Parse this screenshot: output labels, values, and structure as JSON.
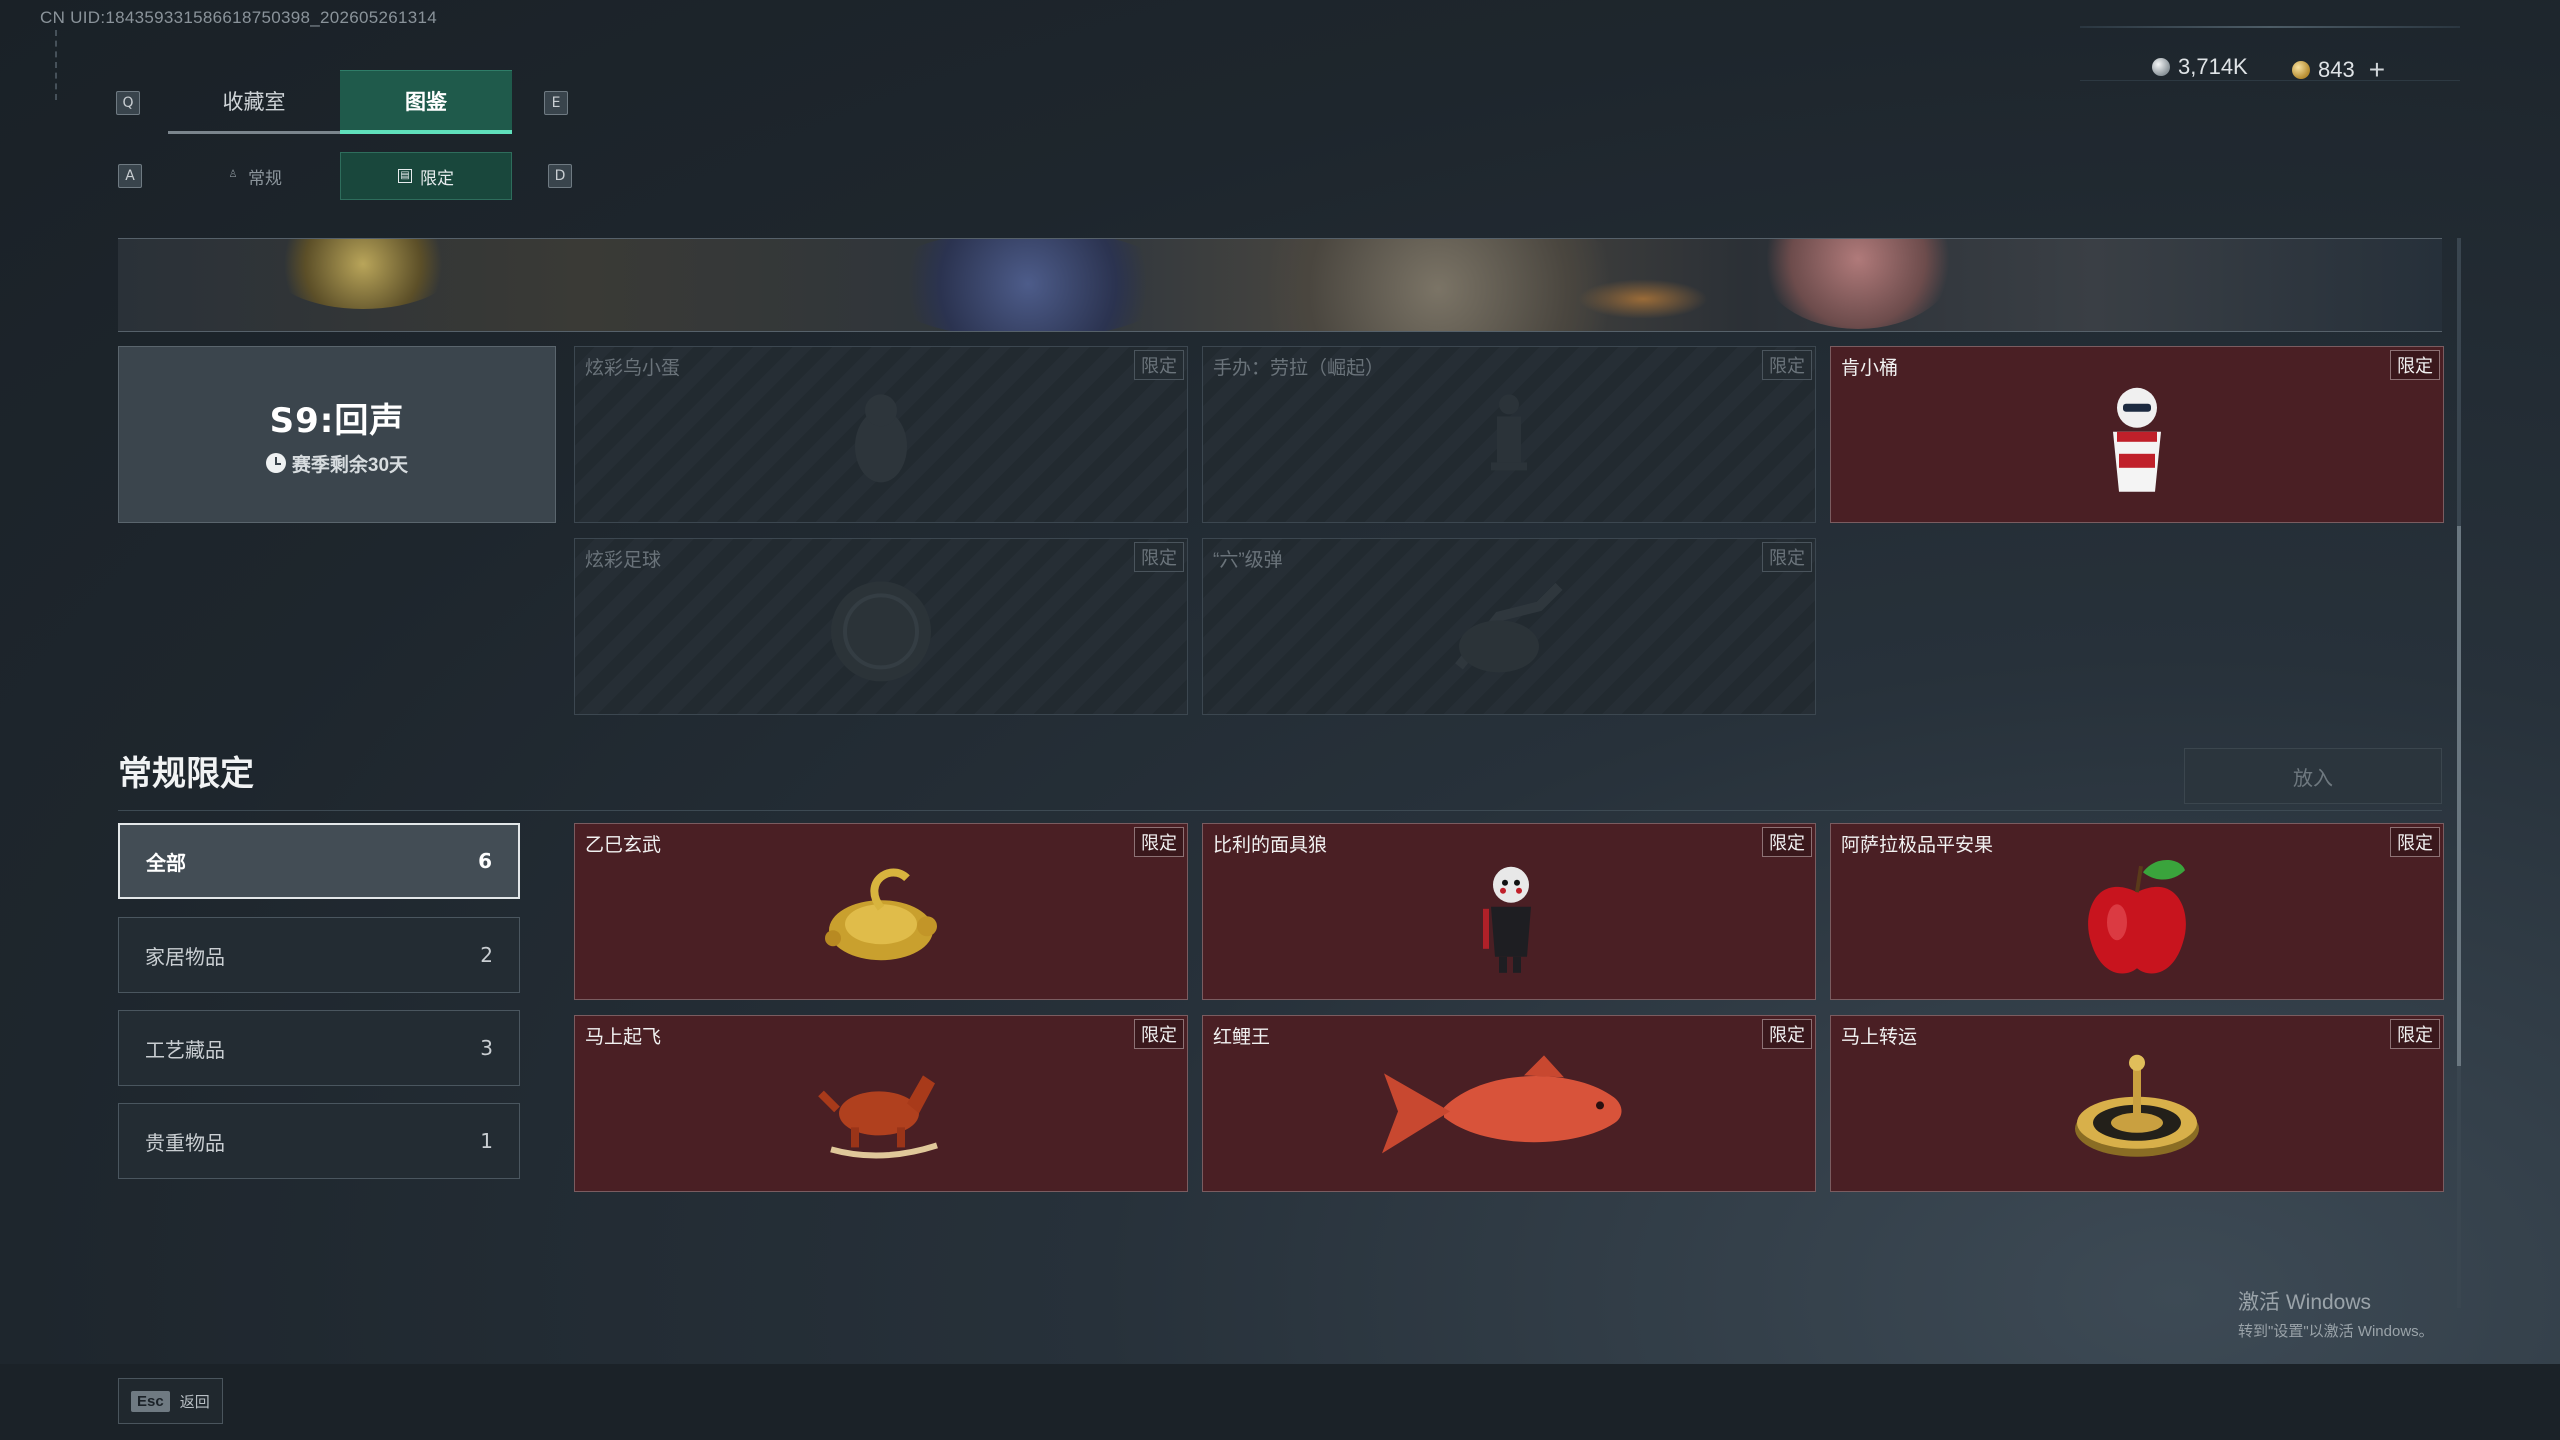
{
  "uid": "CN UID:1843593315866187503​98_202605261314",
  "nav": {
    "key_prev_tab": "Q",
    "key_next_tab": "E",
    "key_prev_sub": "A",
    "key_next_sub": "D",
    "tabs": [
      {
        "label": "收藏室"
      },
      {
        "label": "图鉴"
      }
    ],
    "subtabs": [
      {
        "label": "常规",
        "icon": "figure-icon"
      },
      {
        "label": "限定",
        "icon": "image-icon"
      }
    ]
  },
  "currency": {
    "silver": "3,714K",
    "gold": "843",
    "plus": "+"
  },
  "season": {
    "title": "S9:回声",
    "remaining": "赛季剩余30天"
  },
  "season_items": [
    {
      "name": "炫彩乌小蛋",
      "tag": "限定",
      "owned": false
    },
    {
      "name": "手办：劳拉（崛起）",
      "tag": "限定",
      "owned": false
    },
    {
      "name": "肯小桶",
      "tag": "限定",
      "owned": true
    },
    {
      "name": "炫彩足球",
      "tag": "限定",
      "owned": false
    },
    {
      "name": "“六”级弹",
      "tag": "限定",
      "owned": false
    }
  ],
  "regular": {
    "title": "常规限定",
    "put_button": "放入",
    "filters": [
      {
        "label": "全部",
        "count": "6"
      },
      {
        "label": "家居物品",
        "count": "2"
      },
      {
        "label": "工艺藏品",
        "count": "3"
      },
      {
        "label": "贵重物品",
        "count": "1"
      }
    ],
    "items": [
      {
        "name": "乙巳玄武",
        "tag": "限定"
      },
      {
        "name": "比利的面具狼",
        "tag": "限定"
      },
      {
        "name": "阿萨拉极品平安果",
        "tag": "限定"
      },
      {
        "name": "马上起飞",
        "tag": "限定"
      },
      {
        "name": "红鲤王",
        "tag": "限定"
      },
      {
        "name": "马上转运",
        "tag": "限定"
      }
    ]
  },
  "footer": {
    "esc_key": "Esc",
    "back_label": "返回"
  },
  "watermark": {
    "line1": "激活 Windows",
    "line2": "转到\"设置\"以激活 Windows。"
  }
}
